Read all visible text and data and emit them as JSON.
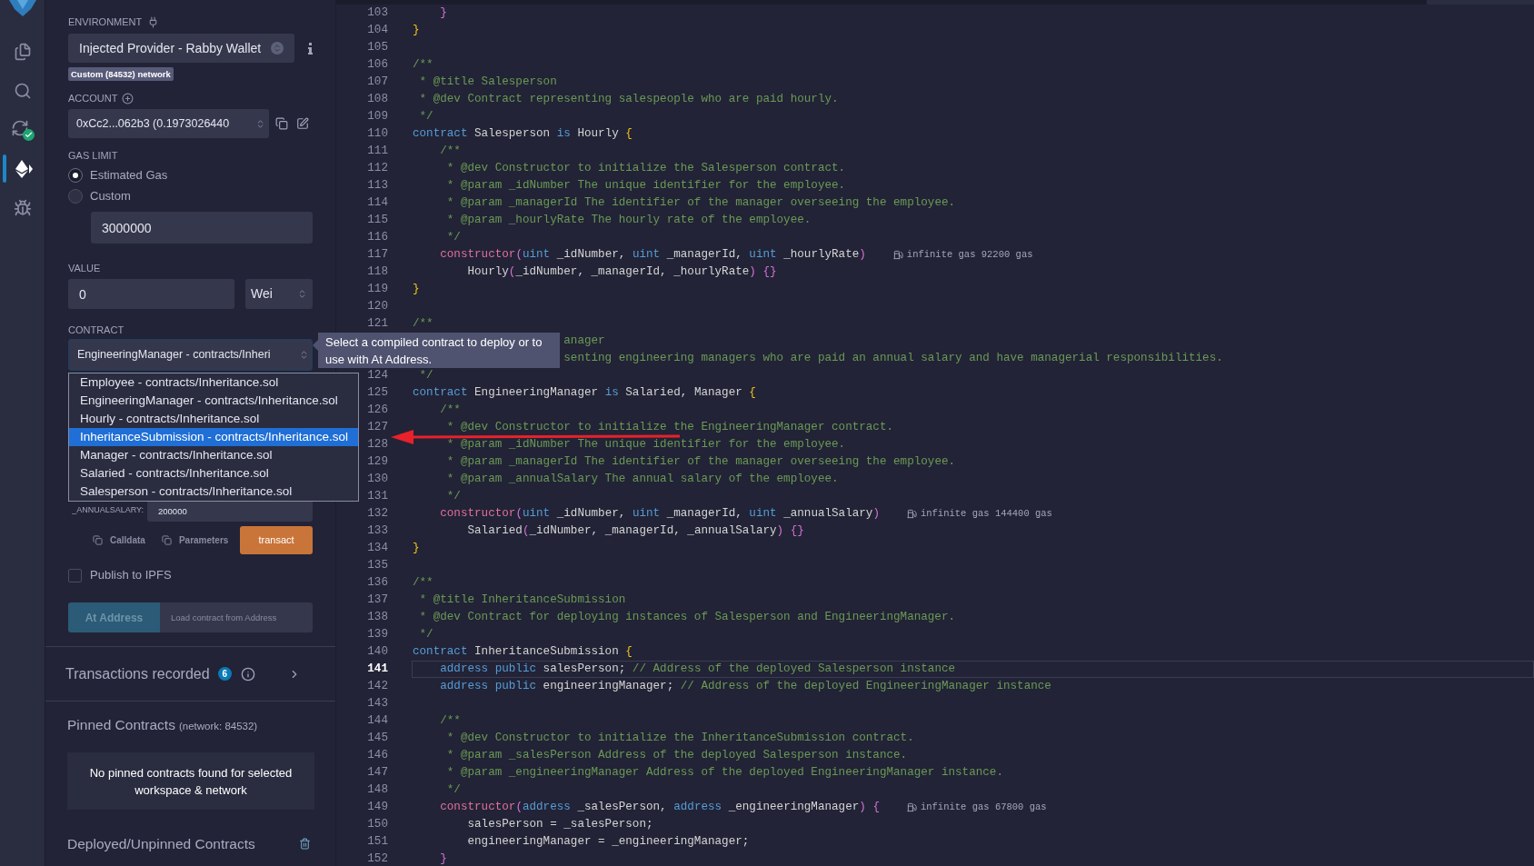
{
  "sidebar_icons": [
    {
      "kind": "files",
      "selected": false
    },
    {
      "kind": "search",
      "selected": false
    },
    {
      "kind": "compiler",
      "selected": false
    },
    {
      "kind": "deploy",
      "selected": true
    },
    {
      "kind": "debugger",
      "selected": false
    }
  ],
  "deploy_panel": {
    "environment": {
      "label": "ENVIRONMENT",
      "value": "Injected Provider - Rabby Wallet",
      "network_badge": "Custom (84532) network"
    },
    "account": {
      "label": "ACCOUNT",
      "value": "0xCc2...062b3 (0.1973026440"
    },
    "gas_limit": {
      "label": "GAS LIMIT",
      "options": [
        {
          "label": "Estimated Gas",
          "selected": true
        },
        {
          "label": "Custom",
          "selected": false
        }
      ],
      "value": "3000000"
    },
    "value": {
      "label": "VALUE",
      "amount": "0",
      "unit": "Wei"
    },
    "contract": {
      "label": "CONTRACT",
      "value": "EngineeringManager - contracts/Inheri",
      "tooltip": "Select a compiled contract to deploy or to use with At Address.",
      "options": [
        {
          "label": "Employee - contracts/Inheritance.sol",
          "selected": false
        },
        {
          "label": "EngineeringManager - contracts/Inheritance.sol",
          "selected": false
        },
        {
          "label": "Hourly - contracts/Inheritance.sol",
          "selected": false
        },
        {
          "label": "InheritanceSubmission - contracts/Inheritance.sol",
          "selected": true
        },
        {
          "label": "Manager - contracts/Inheritance.sol",
          "selected": false
        },
        {
          "label": "Salaried - contracts/Inheritance.sol",
          "selected": false
        },
        {
          "label": "Salesperson - contracts/Inheritance.sol",
          "selected": false
        }
      ]
    },
    "constructor_params": [
      {
        "name": "_ANNUALSALARY:",
        "value": "200000"
      }
    ],
    "actions": {
      "calldata": "Calldata",
      "parameters": "Parameters",
      "transact": "transact"
    },
    "publish_ipfs": {
      "label": "Publish to IPFS",
      "checked": false
    },
    "at_address": {
      "button": "At Address",
      "placeholder": "Load contract from Address"
    },
    "transactions": {
      "label": "Transactions recorded",
      "count": "6"
    },
    "pinned": {
      "title": "Pinned Contracts",
      "network": "(network: 84532)",
      "empty_message": "No pinned contracts found for selected workspace & network"
    },
    "deployed": {
      "title": "Deployed/Unpinned Contracts"
    }
  },
  "editor": {
    "lines": [
      {
        "number": "103",
        "current": false,
        "tokens": [
          {
            "kind": "brace2",
            "text": "    }"
          }
        ]
      },
      {
        "number": "104",
        "current": false,
        "tokens": [
          {
            "kind": "brace1",
            "text": "}"
          }
        ]
      },
      {
        "number": "105",
        "current": false
      },
      {
        "number": "106",
        "current": false,
        "tokens": [
          {
            "kind": "comment",
            "text": "/**"
          }
        ]
      },
      {
        "number": "107",
        "current": false,
        "tokens": [
          {
            "kind": "comment",
            "text": " * @title Salesperson"
          }
        ]
      },
      {
        "number": "108",
        "current": false,
        "tokens": [
          {
            "kind": "comment",
            "text": " * @dev Contract representing salespeople who are paid hourly."
          }
        ]
      },
      {
        "number": "109",
        "current": false,
        "tokens": [
          {
            "kind": "comment",
            "text": " */"
          }
        ]
      },
      {
        "number": "110",
        "current": false,
        "tokens": [
          {
            "kind": "keyword",
            "text": "contract"
          },
          {
            "kind": "plain",
            "text": " Salesperson "
          },
          {
            "kind": "keyword",
            "text": "is"
          },
          {
            "kind": "plain",
            "text": " Hourly "
          },
          {
            "kind": "brace1",
            "text": "{"
          }
        ]
      },
      {
        "number": "111",
        "current": false,
        "tokens": [
          {
            "kind": "comment",
            "text": "    /**"
          }
        ]
      },
      {
        "number": "112",
        "current": false,
        "tokens": [
          {
            "kind": "comment",
            "text": "     * @dev Constructor to initialize the Salesperson contract."
          }
        ]
      },
      {
        "number": "113",
        "current": false,
        "tokens": [
          {
            "kind": "comment",
            "text": "     * @param _idNumber The unique identifier for the employee."
          }
        ]
      },
      {
        "number": "114",
        "current": false,
        "tokens": [
          {
            "kind": "comment",
            "text": "     * @param _managerId The identifier of the manager overseeing the employee."
          }
        ]
      },
      {
        "number": "115",
        "current": false,
        "tokens": [
          {
            "kind": "comment",
            "text": "     * @param _hourlyRate The hourly rate of the employee."
          }
        ]
      },
      {
        "number": "116",
        "current": false,
        "tokens": [
          {
            "kind": "comment",
            "text": "     */"
          }
        ]
      },
      {
        "number": "117",
        "current": false,
        "tokens": [
          {
            "kind": "function",
            "text": "    constructor"
          },
          {
            "kind": "brace2",
            "text": "("
          },
          {
            "kind": "keyword",
            "text": "uint"
          },
          {
            "kind": "plain",
            "text": " _idNumber, "
          },
          {
            "kind": "keyword",
            "text": "uint"
          },
          {
            "kind": "plain",
            "text": " _managerId, "
          },
          {
            "kind": "keyword",
            "text": "uint"
          },
          {
            "kind": "plain",
            "text": " _hourlyRate"
          },
          {
            "kind": "brace2",
            "text": ")"
          }
        ],
        "gas": "infinite gas 92200 gas"
      },
      {
        "number": "118",
        "current": false,
        "tokens": [
          {
            "kind": "plain",
            "text": "        Hourly"
          },
          {
            "kind": "brace2",
            "text": "("
          },
          {
            "kind": "plain",
            "text": "_idNumber, _managerId, _hourlyRate"
          },
          {
            "kind": "brace2",
            "text": ")"
          },
          {
            "kind": "brace2",
            "text": " {}"
          }
        ]
      },
      {
        "number": "119",
        "current": false,
        "tokens": [
          {
            "kind": "brace1",
            "text": "}"
          }
        ]
      },
      {
        "number": "120",
        "current": false
      },
      {
        "number": "121",
        "current": false,
        "tokens": [
          {
            "kind": "comment",
            "text": "/**"
          }
        ]
      },
      {
        "current": false,
        "tokens": [
          {
            "kind": "comment",
            "text": "                      anager"
          }
        ]
      },
      {
        "current": false,
        "tokens": [
          {
            "kind": "comment",
            "text": "                      senting engineering managers who are paid an annual salary and have managerial responsibilities."
          }
        ]
      },
      {
        "number": "124",
        "current": false,
        "tokens": [
          {
            "kind": "comment",
            "text": " */"
          }
        ]
      },
      {
        "number": "125",
        "current": false,
        "tokens": [
          {
            "kind": "keyword",
            "text": "contract"
          },
          {
            "kind": "plain",
            "text": " EngineeringManager "
          },
          {
            "kind": "keyword",
            "text": "is"
          },
          {
            "kind": "plain",
            "text": " Salaried, Manager "
          },
          {
            "kind": "brace1",
            "text": "{"
          }
        ]
      },
      {
        "number": "126",
        "current": false,
        "tokens": [
          {
            "kind": "comment",
            "text": "    /**"
          }
        ]
      },
      {
        "number": "127",
        "current": false,
        "tokens": [
          {
            "kind": "comment",
            "text": "     * @dev Constructor to initialize the EngineeringManager contract."
          }
        ]
      },
      {
        "number": "128",
        "current": false,
        "tokens": [
          {
            "kind": "comment",
            "text": "     * @param _idNumber The unique identifier for the employee."
          }
        ]
      },
      {
        "number": "129",
        "current": false,
        "tokens": [
          {
            "kind": "comment",
            "text": "     * @param _managerId The identifier of the manager overseeing the employee."
          }
        ]
      },
      {
        "number": "130",
        "current": false,
        "tokens": [
          {
            "kind": "comment",
            "text": "     * @param _annualSalary The annual salary of the employee."
          }
        ]
      },
      {
        "number": "131",
        "current": false,
        "tokens": [
          {
            "kind": "comment",
            "text": "     */"
          }
        ]
      },
      {
        "number": "132",
        "current": false,
        "tokens": [
          {
            "kind": "function",
            "text": "    constructor"
          },
          {
            "kind": "brace2",
            "text": "("
          },
          {
            "kind": "keyword",
            "text": "uint"
          },
          {
            "kind": "plain",
            "text": " _idNumber, "
          },
          {
            "kind": "keyword",
            "text": "uint"
          },
          {
            "kind": "plain",
            "text": " _managerId, "
          },
          {
            "kind": "keyword",
            "text": "uint"
          },
          {
            "kind": "plain",
            "text": " _annualSalary"
          },
          {
            "kind": "brace2",
            "text": ")"
          }
        ],
        "gas": "infinite gas 144400 gas"
      },
      {
        "number": "133",
        "current": false,
        "tokens": [
          {
            "kind": "plain",
            "text": "        Salaried"
          },
          {
            "kind": "brace2",
            "text": "("
          },
          {
            "kind": "plain",
            "text": "_idNumber, _managerId, _annualSalary"
          },
          {
            "kind": "brace2",
            "text": ")"
          },
          {
            "kind": "brace2",
            "text": " {}"
          }
        ]
      },
      {
        "number": "134",
        "current": false,
        "tokens": [
          {
            "kind": "brace1",
            "text": "}"
          }
        ]
      },
      {
        "number": "135",
        "current": false
      },
      {
        "number": "136",
        "current": false,
        "tokens": [
          {
            "kind": "comment",
            "text": "/**"
          }
        ]
      },
      {
        "number": "137",
        "current": false,
        "tokens": [
          {
            "kind": "comment",
            "text": " * @title InheritanceSubmission"
          }
        ]
      },
      {
        "number": "138",
        "current": false,
        "tokens": [
          {
            "kind": "comment",
            "text": " * @dev Contract for deploying instances of Salesperson and EngineeringManager."
          }
        ]
      },
      {
        "number": "139",
        "current": false,
        "tokens": [
          {
            "kind": "comment",
            "text": " */"
          }
        ]
      },
      {
        "number": "140",
        "current": false,
        "tokens": [
          {
            "kind": "keyword",
            "text": "contract"
          },
          {
            "kind": "plain",
            "text": " InheritanceSubmission "
          },
          {
            "kind": "brace1",
            "text": "{"
          }
        ]
      },
      {
        "number": "141",
        "current": true,
        "tokens": [
          {
            "kind": "keyword",
            "text": "    address"
          },
          {
            "kind": "keyword",
            "text": " public"
          },
          {
            "kind": "plain",
            "text": " salesPerson; "
          },
          {
            "kind": "comment",
            "text": "// Address of the deployed Salesperson instance"
          }
        ]
      },
      {
        "number": "142",
        "current": false,
        "tokens": [
          {
            "kind": "keyword",
            "text": "    address"
          },
          {
            "kind": "keyword",
            "text": " public"
          },
          {
            "kind": "plain",
            "text": " engineeringManager; "
          },
          {
            "kind": "comment",
            "text": "// Address of the deployed EngineeringManager instance"
          }
        ]
      },
      {
        "number": "143",
        "current": false
      },
      {
        "number": "144",
        "current": false,
        "tokens": [
          {
            "kind": "comment",
            "text": "    /**"
          }
        ]
      },
      {
        "number": "145",
        "current": false,
        "tokens": [
          {
            "kind": "comment",
            "text": "     * @dev Constructor to initialize the InheritanceSubmission contract."
          }
        ]
      },
      {
        "number": "146",
        "current": false,
        "tokens": [
          {
            "kind": "comment",
            "text": "     * @param _salesPerson Address of the deployed Salesperson instance."
          }
        ]
      },
      {
        "number": "147",
        "current": false,
        "tokens": [
          {
            "kind": "comment",
            "text": "     * @param _engineeringManager Address of the deployed EngineeringManager instance."
          }
        ]
      },
      {
        "number": "148",
        "current": false,
        "tokens": [
          {
            "kind": "comment",
            "text": "     */"
          }
        ]
      },
      {
        "number": "149",
        "current": false,
        "tokens": [
          {
            "kind": "function",
            "text": "    constructor"
          },
          {
            "kind": "brace2",
            "text": "("
          },
          {
            "kind": "keyword",
            "text": "address"
          },
          {
            "kind": "plain",
            "text": " _salesPerson, "
          },
          {
            "kind": "keyword",
            "text": "address"
          },
          {
            "kind": "plain",
            "text": " _engineeringManager"
          },
          {
            "kind": "brace2",
            "text": ")"
          },
          {
            "kind": "brace2",
            "text": " {"
          }
        ],
        "gas": "infinite gas 67800 gas"
      },
      {
        "number": "150",
        "current": false,
        "tokens": [
          {
            "kind": "plain",
            "text": "        salesPerson = _salesPerson;"
          }
        ]
      },
      {
        "number": "151",
        "current": false,
        "tokens": [
          {
            "kind": "plain",
            "text": "        engineeringManager = _engineeringManager;"
          }
        ]
      },
      {
        "number": "152",
        "current": false,
        "tokens": [
          {
            "kind": "brace2",
            "text": "    }"
          }
        ]
      }
    ]
  }
}
